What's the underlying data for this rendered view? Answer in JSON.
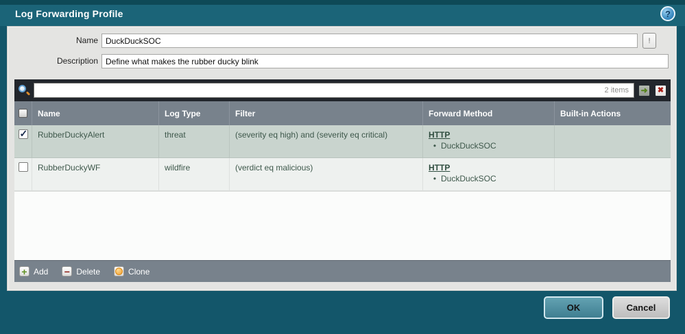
{
  "dialog": {
    "title": "Log Forwarding Profile"
  },
  "form": {
    "name_label": "Name",
    "name_value": "DuckDuckSOC",
    "description_label": "Description",
    "description_value": "Define what makes the rubber ducky blink"
  },
  "filter_bar": {
    "search_value": "",
    "items_count": "2 items"
  },
  "table": {
    "columns": {
      "name": "Name",
      "log_type": "Log Type",
      "filter": "Filter",
      "forward_method": "Forward Method",
      "built_in_actions": "Built-in Actions"
    },
    "rows": [
      {
        "checked": true,
        "name": "RubberDuckyAlert",
        "log_type": "threat",
        "filter": "(severity eq high) and (severity eq critical)",
        "forward_method_link": "HTTP",
        "forward_method_item": "DuckDuckSOC",
        "built_in_actions": ""
      },
      {
        "checked": false,
        "name": "RubberDuckyWF",
        "log_type": "wildfire",
        "filter": "(verdict eq malicious)",
        "forward_method_link": "HTTP",
        "forward_method_item": "DuckDuckSOC",
        "built_in_actions": ""
      }
    ]
  },
  "toolbar": {
    "add": "Add",
    "delete": "Delete",
    "clone": "Clone"
  },
  "footer": {
    "ok": "OK",
    "cancel": "Cancel"
  },
  "colors": {
    "background": "#13566a",
    "titlebar": "#1b6478",
    "panel": "#e4e4e2",
    "table_header": "#78828c",
    "selected_row": "#c9d4ce",
    "row_text": "#3e584b",
    "search_bar": "#22262c",
    "ok_button": "#4b8fa2"
  }
}
